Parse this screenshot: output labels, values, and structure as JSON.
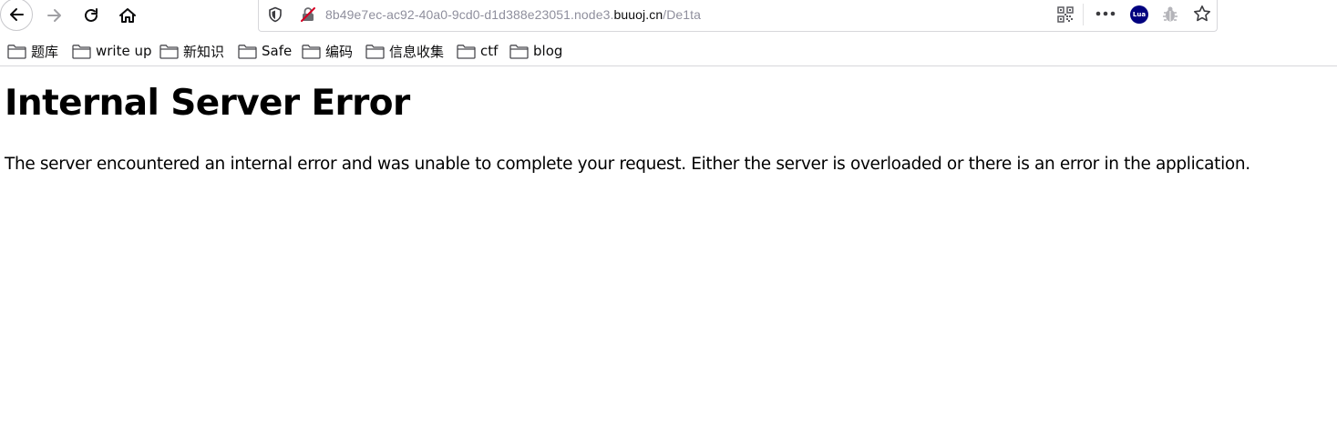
{
  "browser": {
    "url": {
      "subdomain": "8b49e7ec-ac92-40a0-9cd0-d1d388e23051.node3.",
      "domain": "buuoj.cn",
      "path": "/De1ta"
    },
    "extension_lua_label": "Lua",
    "icons": [
      "back-arrow-icon",
      "forward-arrow-icon",
      "reload-icon",
      "home-icon",
      "shield-icon",
      "insecure-lock-icon",
      "qr-code-icon",
      "more-dots-icon",
      "bug-icon",
      "star-icon",
      "folder-icon"
    ]
  },
  "bookmarks": [
    {
      "label": "题库"
    },
    {
      "label": "write up"
    },
    {
      "label": "新知识"
    },
    {
      "label": "Safe"
    },
    {
      "label": "编码"
    },
    {
      "label": "信息收集"
    },
    {
      "label": "ctf"
    },
    {
      "label": "blog"
    }
  ],
  "page": {
    "title": "Internal Server Error",
    "message": "The server encountered an internal error and was unable to complete your request. Either the server is overloaded or there is an error in the application."
  },
  "colors": {
    "lua_badge": "#00007f",
    "insecure_slash": "#d70022",
    "url_muted": "#8f8f9d"
  }
}
